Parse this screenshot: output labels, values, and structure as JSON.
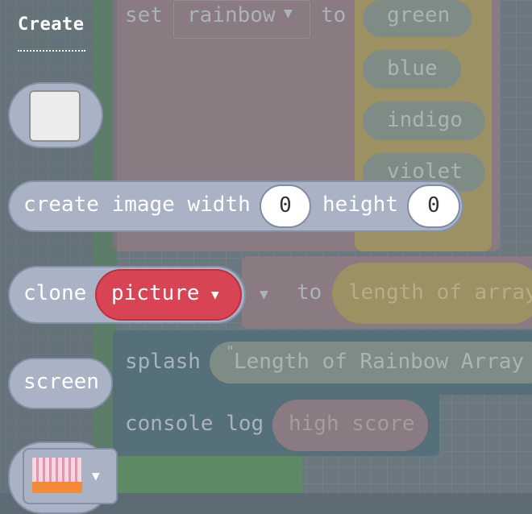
{
  "flyout": {
    "title": "Create",
    "create_image": {
      "label1": "create image width",
      "width": "0",
      "label2": "height",
      "height": "0"
    },
    "clone": {
      "label": "clone",
      "variable": "picture"
    },
    "screen": {
      "label": "screen"
    }
  },
  "workspace": {
    "set_block": {
      "set": "set",
      "var": "rainbow",
      "to": "to"
    },
    "array_items": [
      "green",
      "blue",
      "indigo",
      "violet"
    ],
    "set2": {
      "to": "to",
      "value": "length of array"
    },
    "splash": {
      "label": "splash",
      "text": "Length of Rainbow Array"
    },
    "console": {
      "label": "console log",
      "value": "high score"
    }
  },
  "colors": {
    "clone_var": "#d94455",
    "flyout_block": "#a9b3c5"
  }
}
